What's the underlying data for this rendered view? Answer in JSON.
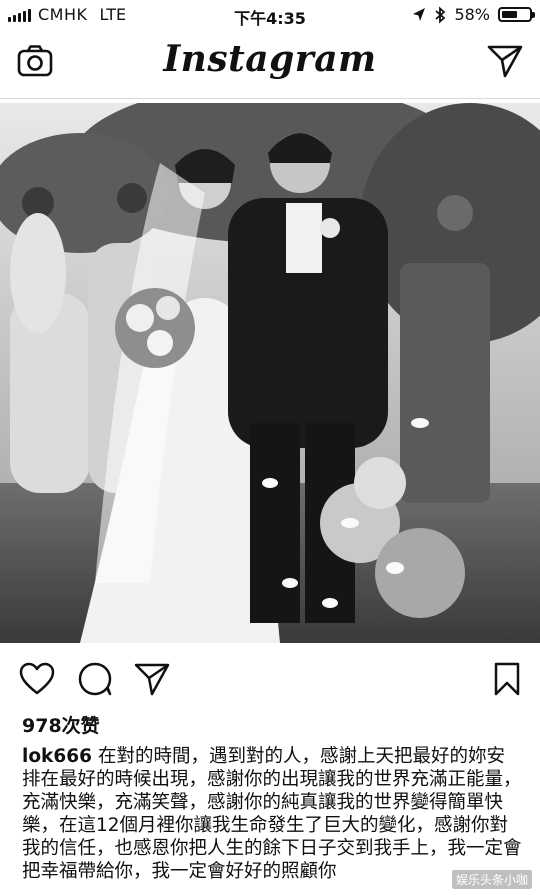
{
  "status_bar": {
    "carrier": "CMHK",
    "network": "LTE",
    "time": "下午4:35",
    "battery_percent": "58%",
    "battery_level": 0.58
  },
  "header": {
    "logo": "Instagram",
    "left_icon": "camera-icon",
    "right_icon": "direct-message-icon"
  },
  "post": {
    "actions": [
      "heart-icon",
      "comment-icon",
      "share-icon",
      "bookmark-icon"
    ],
    "likes": "978次赞",
    "username": "lok666",
    "caption": "在對的時間，遇到對的人，感謝上天把最好的妳安排在最好的時候出現，感謝你的出現讓我的世界充滿正能量，充滿快樂，充滿笑聲，感謝你的純真讓我的世界變得簡單快樂，在這12個月裡你讓我生命發生了巨大的變化，感謝你對我的信任，也感恩你把人生的餘下日子交到我手上，我一定會把幸福帶給你，我一定會好好的照顧你"
  },
  "watermark": "娱乐头条小咖"
}
